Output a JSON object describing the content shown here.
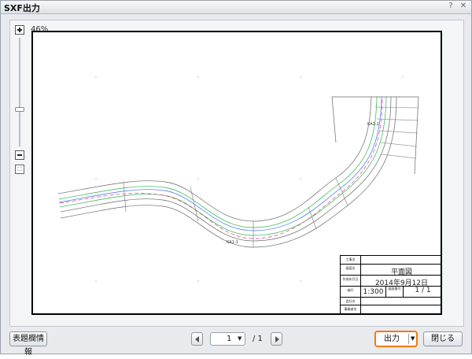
{
  "window": {
    "title": "SXF出力",
    "help_glyph": "?",
    "close_glyph": "✕"
  },
  "viewer": {
    "zoom_percent": "46%",
    "zoom_level": 0.46,
    "fit_glyph": "⛶"
  },
  "titleblock": {
    "rows": [
      {
        "label": "工事名",
        "value": ""
      },
      {
        "label": "図面名",
        "value": "平面図"
      },
      {
        "label": "作成年月日",
        "value": "2014年9月12日"
      },
      {
        "label": "縮尺",
        "value": "1:300",
        "label2": "図面番号",
        "value2": "1 / 1"
      },
      {
        "label": "会社名",
        "value": ""
      },
      {
        "label": "事業者名",
        "value": ""
      }
    ]
  },
  "drawing": {
    "labels": [
      "KA1-2",
      "KA1-1"
    ]
  },
  "footer": {
    "title_info_button": "表題欄情報",
    "page_current": "1",
    "page_total": "/ 1",
    "output_button": "出力",
    "close_button": "閉じる"
  },
  "colors": {
    "accent": "#f07a0a",
    "road_outline": "#555555",
    "lane_green": "#2ab54a",
    "lane_blue": "#3a6cf0",
    "centerline_pink": "#e0408a"
  }
}
